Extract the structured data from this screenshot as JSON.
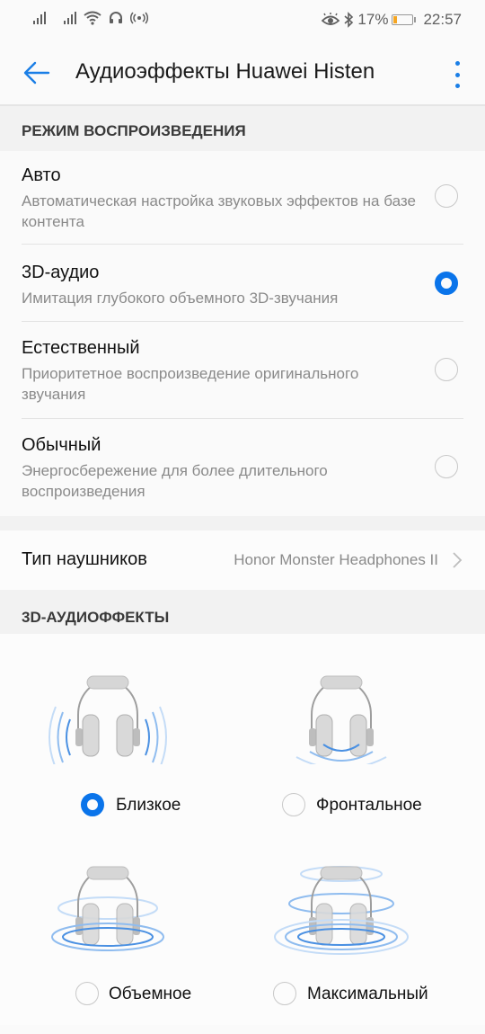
{
  "status_bar": {
    "icons": [
      "signal-icon",
      "signal-icon",
      "wifi-icon",
      "headset-icon",
      "hotspot-icon"
    ],
    "right_icons": [
      "eye-comfort-icon",
      "bluetooth-icon"
    ],
    "battery_percent": "17%",
    "battery_level": 0.17,
    "time": "22:57",
    "battery_color": "#f5a623"
  },
  "app_bar": {
    "title": "Аудиоэффекты Huawei Histen",
    "back_icon": "arrow-left-icon",
    "more_icon": "more-vertical-icon"
  },
  "accent_color": "#0a74ea",
  "playback_mode": {
    "header": "РЕЖИМ ВОСПРОИЗВЕДЕНИЯ",
    "options": [
      {
        "title": "Авто",
        "description": "Автоматическая настройка звуковых эффектов на базе контента",
        "selected": false
      },
      {
        "title": "3D-аудио",
        "description": "Имитация глубокого объемного 3D-звучания",
        "selected": true
      },
      {
        "title": "Естественный",
        "description": "Приоритетное воспроизведение оригинального звучания",
        "selected": false
      },
      {
        "title": "Обычный",
        "description": "Энергосбережение для более длительного воспроизведения",
        "selected": false
      }
    ]
  },
  "headphones": {
    "label": "Тип наушников",
    "value": "Honor Monster Headphones II",
    "chevron_icon": "chevron-right-icon"
  },
  "effects_3d": {
    "header": "3D-АУДИОФФЕКТЫ",
    "options": [
      {
        "label": "Близкое",
        "icon": "headphones-near-icon",
        "selected": true
      },
      {
        "label": "Фронтальное",
        "icon": "headphones-front-icon",
        "selected": false
      },
      {
        "label": "Объемное",
        "icon": "headphones-surround-icon",
        "selected": false
      },
      {
        "label": "Максимальный",
        "icon": "headphones-max-icon",
        "selected": false
      }
    ]
  }
}
